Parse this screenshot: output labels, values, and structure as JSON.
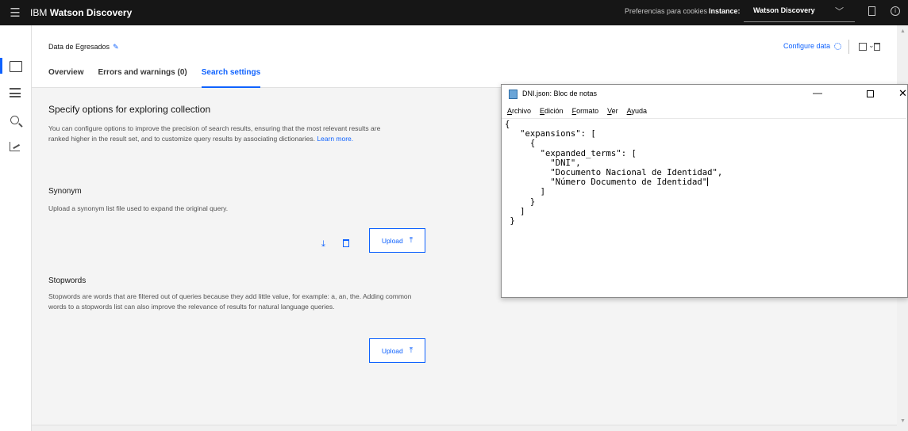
{
  "topbar": {
    "brand_prefix": "IBM",
    "brand_name": "Watson Discovery",
    "cookies_link": "Preferencias para cookies",
    "instance_label": "Instance:",
    "instance_value": "Watson Discovery"
  },
  "sidenav": {
    "items": [
      {
        "icon": "folder-icon",
        "active": true
      },
      {
        "icon": "query-builder-icon",
        "active": false
      },
      {
        "icon": "search-icon",
        "active": false
      },
      {
        "icon": "chart-icon",
        "active": false
      }
    ]
  },
  "header": {
    "collection_name": "Data de Egresados",
    "configure_data": "Configure data",
    "tabs": [
      {
        "label": "Overview",
        "active": false
      },
      {
        "label": "Errors and warnings (0)",
        "active": false
      },
      {
        "label": "Search settings",
        "active": true
      }
    ]
  },
  "content": {
    "title": "Specify options for exploring collection",
    "description": "You can configure options to improve the precision of search results, ensuring that the most relevant results are ranked higher in the result set, and to customize query results by associating dictionaries.",
    "learn_more": "Learn more.",
    "synonym": {
      "title": "Synonym",
      "description": "Upload a synonym list file used to expand the original query.",
      "upload_label": "Upload"
    },
    "stopwords": {
      "title": "Stopwords",
      "description": "Stopwords are words that are filtered out of queries because they add little value, for example: a, an, the. Adding common words to a stopwords list can also improve the relevance of results for natural language queries.",
      "upload_label": "Upload"
    }
  },
  "notepad": {
    "title": "DNI.json: Bloc de notas",
    "menu": [
      "Archivo",
      "Edición",
      "Formato",
      "Ver",
      "Ayuda"
    ],
    "text": "{\n   \"expansions\": [\n     {\n       \"expanded_terms\": [\n         \"DNI\",\n         \"Documento Nacional de Identidad\",\n         \"Número Documento de Identidad\"",
    "text_tail": "\n       ]\n     }\n   ]\n }"
  },
  "colors": {
    "accent": "#0f62fe",
    "topbar_bg": "#161616",
    "page_bg": "#f4f4f4"
  }
}
